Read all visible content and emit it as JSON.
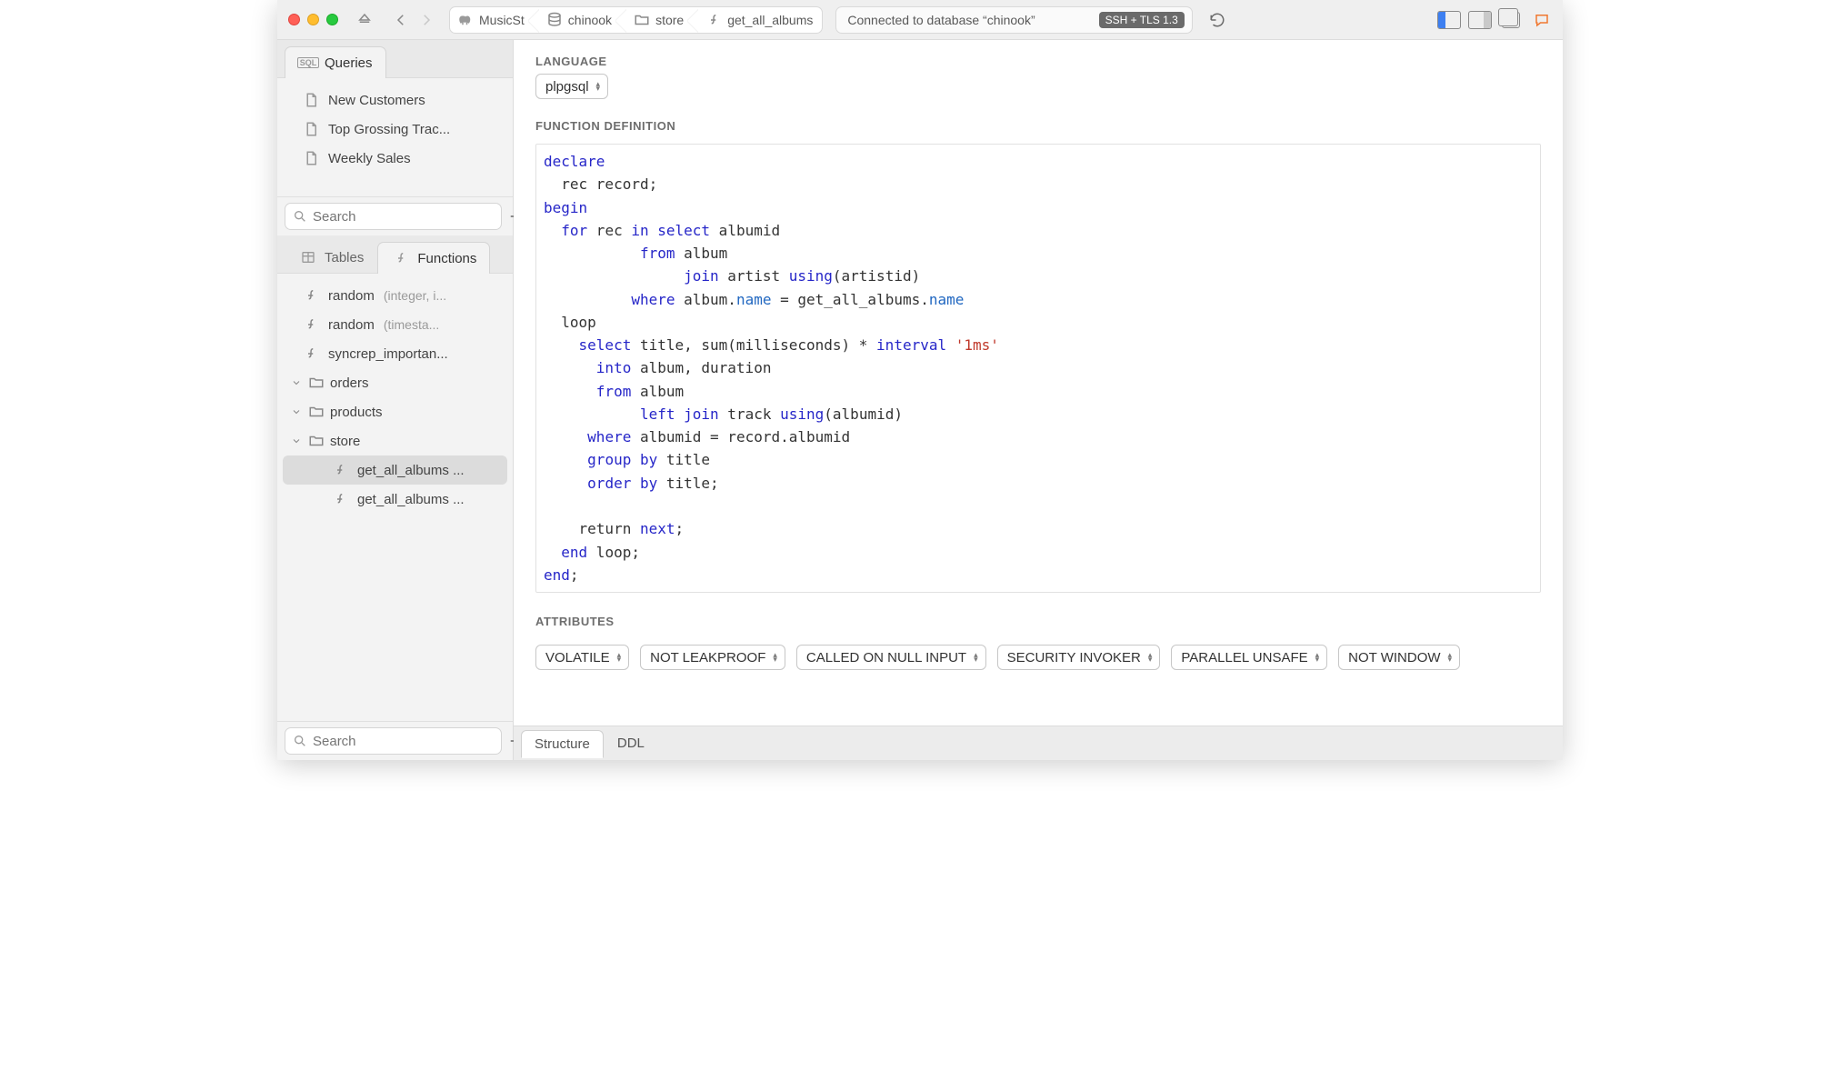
{
  "toolbar": {
    "breadcrumb": [
      {
        "icon": "elephant",
        "label": "MusicSt"
      },
      {
        "icon": "db",
        "label": "chinook"
      },
      {
        "icon": "folder",
        "label": "store"
      },
      {
        "icon": "fn",
        "label": "get_all_albums"
      }
    ],
    "status_text": "Connected to database “chinook”",
    "status_badge": "SSH + TLS 1.3"
  },
  "sidebar_top": {
    "tab_label": "Queries",
    "items": [
      {
        "label": "New Customers"
      },
      {
        "label": "Top Grossing Trac..."
      },
      {
        "label": "Weekly Sales"
      }
    ],
    "search_placeholder": "Search"
  },
  "sidebar_bottom": {
    "tabs": {
      "tables": "Tables",
      "functions": "Functions",
      "active": "functions"
    },
    "items": [
      {
        "type": "fn",
        "name": "random",
        "sig": "(integer, i..."
      },
      {
        "type": "fn",
        "name": "random",
        "sig": "(timesta..."
      },
      {
        "type": "fn",
        "name": "syncrep_importan..."
      },
      {
        "type": "folder",
        "name": "orders",
        "open": true
      },
      {
        "type": "folder",
        "name": "products",
        "open": true
      },
      {
        "type": "folder",
        "name": "store",
        "open": true,
        "children": [
          {
            "type": "fn",
            "name": "get_all_albums ...",
            "selected": true
          },
          {
            "type": "fn",
            "name": "get_all_albums ..."
          }
        ]
      }
    ],
    "search_placeholder": "Search"
  },
  "editor": {
    "language_label": "LANGUAGE",
    "language_value": "plpgsql",
    "definition_label": "FUNCTION DEFINITION",
    "code_tokens": [
      [
        [
          "kw",
          "declare"
        ]
      ],
      [
        [
          "txt",
          "  rec record;"
        ]
      ],
      [
        [
          "kw",
          "begin"
        ]
      ],
      [
        [
          "txt",
          "  "
        ],
        [
          "kw",
          "for"
        ],
        [
          "txt",
          " rec "
        ],
        [
          "kw",
          "in"
        ],
        [
          "txt",
          " "
        ],
        [
          "kw",
          "select"
        ],
        [
          "txt",
          " albumid"
        ]
      ],
      [
        [
          "txt",
          "           "
        ],
        [
          "kw",
          "from"
        ],
        [
          "txt",
          " album"
        ]
      ],
      [
        [
          "txt",
          "                "
        ],
        [
          "kw",
          "join"
        ],
        [
          "txt",
          " artist "
        ],
        [
          "kw",
          "using"
        ],
        [
          "txt",
          "(artistid)"
        ]
      ],
      [
        [
          "txt",
          "          "
        ],
        [
          "kw",
          "where"
        ],
        [
          "txt",
          " album."
        ],
        [
          "mem",
          "name"
        ],
        [
          "txt",
          " = get_all_albums."
        ],
        [
          "mem",
          "name"
        ]
      ],
      [
        [
          "txt",
          "  loop"
        ]
      ],
      [
        [
          "txt",
          "    "
        ],
        [
          "kw",
          "select"
        ],
        [
          "txt",
          " title, sum(milliseconds) * "
        ],
        [
          "kw",
          "interval"
        ],
        [
          "txt",
          " "
        ],
        [
          "str",
          "'1ms'"
        ]
      ],
      [
        [
          "txt",
          "      "
        ],
        [
          "kw",
          "into"
        ],
        [
          "txt",
          " album, duration"
        ]
      ],
      [
        [
          "txt",
          "      "
        ],
        [
          "kw",
          "from"
        ],
        [
          "txt",
          " album"
        ]
      ],
      [
        [
          "txt",
          "           "
        ],
        [
          "kw",
          "left join"
        ],
        [
          "txt",
          " track "
        ],
        [
          "kw",
          "using"
        ],
        [
          "txt",
          "(albumid)"
        ]
      ],
      [
        [
          "txt",
          "     "
        ],
        [
          "kw",
          "where"
        ],
        [
          "txt",
          " albumid = record.albumid"
        ]
      ],
      [
        [
          "txt",
          "     "
        ],
        [
          "kw",
          "group by"
        ],
        [
          "txt",
          " title"
        ]
      ],
      [
        [
          "txt",
          "     "
        ],
        [
          "kw",
          "order by"
        ],
        [
          "txt",
          " title;"
        ]
      ],
      [
        [
          "txt",
          ""
        ]
      ],
      [
        [
          "txt",
          "    return "
        ],
        [
          "kw",
          "next"
        ],
        [
          "txt",
          ";"
        ]
      ],
      [
        [
          "txt",
          "  "
        ],
        [
          "kw",
          "end"
        ],
        [
          "txt",
          " loop;"
        ]
      ],
      [
        [
          "kw",
          "end"
        ],
        [
          "txt",
          ";"
        ]
      ]
    ],
    "attributes_label": "ATTRIBUTES",
    "attributes": [
      "VOLATILE",
      "NOT LEAKPROOF",
      "CALLED ON NULL INPUT",
      "SECURITY INVOKER",
      "PARALLEL UNSAFE",
      "NOT WINDOW"
    ]
  },
  "bottom_tabs": {
    "structure": "Structure",
    "ddl": "DDL",
    "active": "structure"
  }
}
